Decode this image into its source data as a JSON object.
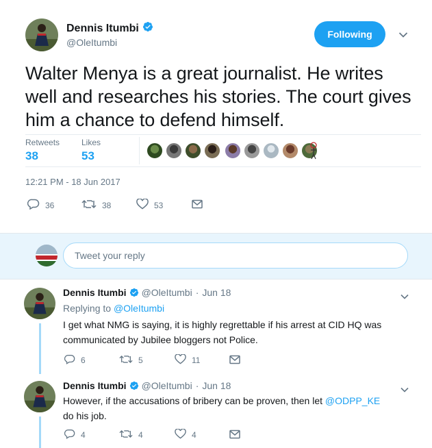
{
  "main_tweet": {
    "author_name": "Dennis Itumbi",
    "handle": "@OleItumbi",
    "follow_label": "Following",
    "text": "Walter Menya is a great journalist. He writes well and researches his stories. The court gives him a chance to defend himself.",
    "retweets_label": "Retweets",
    "retweets_count": "38",
    "likes_label": "Likes",
    "likes_count": "53",
    "timestamp": "12:21 PM - 18 Jun 2017",
    "actions": {
      "replies": "36",
      "retweets": "38",
      "likes": "53"
    }
  },
  "reply_box": {
    "placeholder": "Tweet your reply"
  },
  "thread": [
    {
      "author_name": "Dennis Itumbi",
      "handle": "@OleItumbi",
      "separator": "·",
      "date": "Jun 18",
      "replying_prefix": "Replying to",
      "replying_to": "@OleItumbi",
      "text": "I get what NMG is saying, it is highly regrettable  if his arrest at CID HQ was communicated by Jubilee bloggers not Police.",
      "actions": {
        "replies": "6",
        "retweets": "5",
        "likes": "11"
      }
    },
    {
      "author_name": "Dennis Itumbi",
      "handle": "@OleItumbi",
      "separator": "·",
      "date": "Jun 18",
      "text_before": "However, if the accusations of bribery can be proven, then let ",
      "mention": "@ODPP_KE",
      "text_after": " do his job.",
      "actions": {
        "replies": "4",
        "retweets": "4",
        "likes": "4"
      }
    }
  ],
  "colors": {
    "accent": "#1da1f2",
    "muted": "#657786",
    "reply_bg": "#e8f5fd"
  },
  "icons": [
    "verified-badge-icon",
    "chevron-down-icon",
    "reply-icon",
    "retweet-icon",
    "like-icon",
    "direct-message-icon"
  ]
}
